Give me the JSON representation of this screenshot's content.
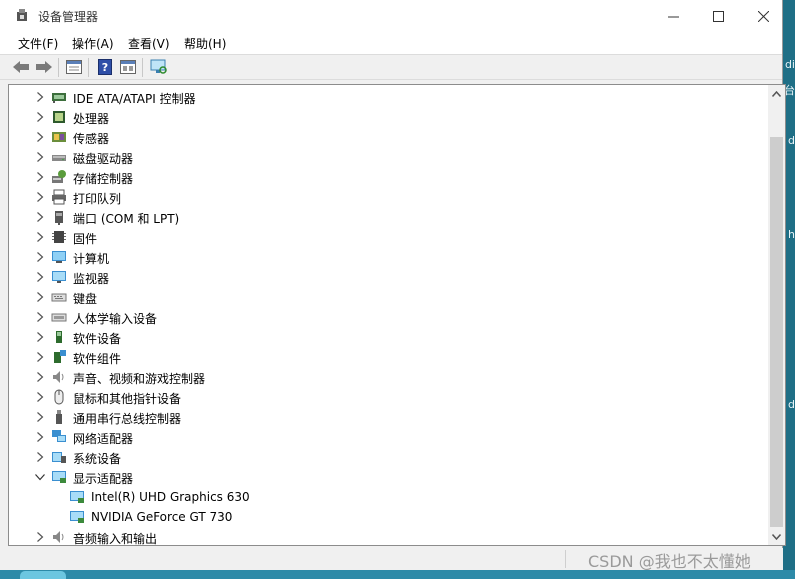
{
  "window": {
    "title": "设备管理器",
    "controls": {
      "minimize": "—",
      "maximize": "☐",
      "close": "✕"
    }
  },
  "menu": [
    {
      "label": "文件(F)"
    },
    {
      "label": "操作(A)"
    },
    {
      "label": "查看(V)"
    },
    {
      "label": "帮助(H)"
    }
  ],
  "toolbar": {
    "buttons": [
      "back-arrow-icon",
      "forward-arrow-icon",
      "properties-icon",
      "help-icon",
      "view-icon",
      "monitor-scan-icon"
    ]
  },
  "tree": [
    {
      "label": "IDE ATA/ATAPI 控制器",
      "expanded": false,
      "icon": "ide-controller-icon"
    },
    {
      "label": "处理器",
      "expanded": false,
      "icon": "processor-icon"
    },
    {
      "label": "传感器",
      "expanded": false,
      "icon": "sensor-icon"
    },
    {
      "label": "磁盘驱动器",
      "expanded": false,
      "icon": "disk-drive-icon"
    },
    {
      "label": "存储控制器",
      "expanded": false,
      "icon": "storage-controller-icon"
    },
    {
      "label": "打印队列",
      "expanded": false,
      "icon": "printer-icon"
    },
    {
      "label": "端口 (COM 和 LPT)",
      "expanded": false,
      "icon": "port-icon"
    },
    {
      "label": "固件",
      "expanded": false,
      "icon": "firmware-icon"
    },
    {
      "label": "计算机",
      "expanded": false,
      "icon": "computer-icon"
    },
    {
      "label": "监视器",
      "expanded": false,
      "icon": "monitor-icon"
    },
    {
      "label": "键盘",
      "expanded": false,
      "icon": "keyboard-icon"
    },
    {
      "label": "人体学输入设备",
      "expanded": false,
      "icon": "hid-icon"
    },
    {
      "label": "软件设备",
      "expanded": false,
      "icon": "software-device-icon"
    },
    {
      "label": "软件组件",
      "expanded": false,
      "icon": "software-component-icon"
    },
    {
      "label": "声音、视频和游戏控制器",
      "expanded": false,
      "icon": "speaker-icon"
    },
    {
      "label": "鼠标和其他指针设备",
      "expanded": false,
      "icon": "mouse-icon"
    },
    {
      "label": "通用串行总线控制器",
      "expanded": false,
      "icon": "usb-icon"
    },
    {
      "label": "网络适配器",
      "expanded": false,
      "icon": "network-adapter-icon"
    },
    {
      "label": "系统设备",
      "expanded": false,
      "icon": "system-device-icon"
    },
    {
      "label": "显示适配器",
      "expanded": true,
      "icon": "display-adapter-icon"
    },
    {
      "label": "Intel(R) UHD Graphics 630",
      "child": true,
      "icon": "display-adapter-icon"
    },
    {
      "label": "NVIDIA GeForce GT 730",
      "child": true,
      "icon": "display-adapter-icon"
    },
    {
      "label": "音频输入和输出",
      "expanded": false,
      "icon": "speaker-icon"
    }
  ],
  "desktop_fragments": [
    "di",
    "台",
    "d",
    "h",
    "d"
  ],
  "watermark": "CSDN @我也不太懂她",
  "colors": {
    "accent": "#0a6e8f",
    "window_bg": "#f0f0f0",
    "tree_bg": "#ffffff"
  }
}
